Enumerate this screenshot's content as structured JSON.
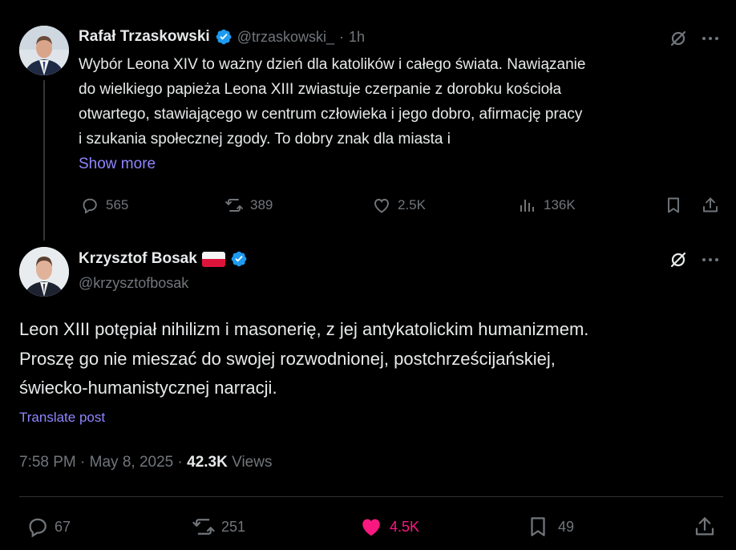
{
  "first_tweet": {
    "author_name": "Rafał Trzaskowski",
    "handle": "@trzaskowski_",
    "separator": "·",
    "time": "1h",
    "text_lines": [
      "Wybór Leona XIV to ważny dzień dla katolików i całego świata. Nawiązanie",
      "do wielkiego papieża Leona XIII zwiastuje czerpanie z dorobku kościoła",
      "otwartego, stawiającego w centrum człowieka i jego dobro, afirmację pracy",
      "i szukania społecznej zgody. To dobry znak dla miasta i"
    ],
    "show_more": "Show more",
    "stats": {
      "replies": "565",
      "reposts": "389",
      "likes": "2.5K",
      "views": "136K"
    }
  },
  "main_tweet": {
    "author_name": "Krzysztof Bosak",
    "handle": "@krzysztofbosak",
    "text_lines": [
      "Leon XIII potępiał nihilizm i masonerię, z jej antykatolickim humanizmem.",
      "Proszę go nie mieszać do swojej rozwodnionej, postchrześcijańskiej,",
      "świecko-humanistycznej narracji."
    ],
    "translate": "Translate post",
    "time": "7:58 PM",
    "date": "May 8, 2025",
    "views_count": "42.3K",
    "views_label": "Views",
    "stats": {
      "replies": "67",
      "reposts": "251",
      "likes": "4.5K",
      "bookmarks": "49"
    }
  },
  "colors": {
    "background": "#000000",
    "text": "#e7e9ea",
    "secondary": "#71767b",
    "link": "#8f86ff",
    "verified": "#1d9bf0",
    "like_active": "#f91880"
  },
  "icons": [
    "verified-badge-icon",
    "grok-icon",
    "more-icon",
    "reply-icon",
    "repost-icon",
    "like-icon",
    "views-icon",
    "bookmark-icon",
    "share-icon",
    "poland-flag-icon"
  ]
}
